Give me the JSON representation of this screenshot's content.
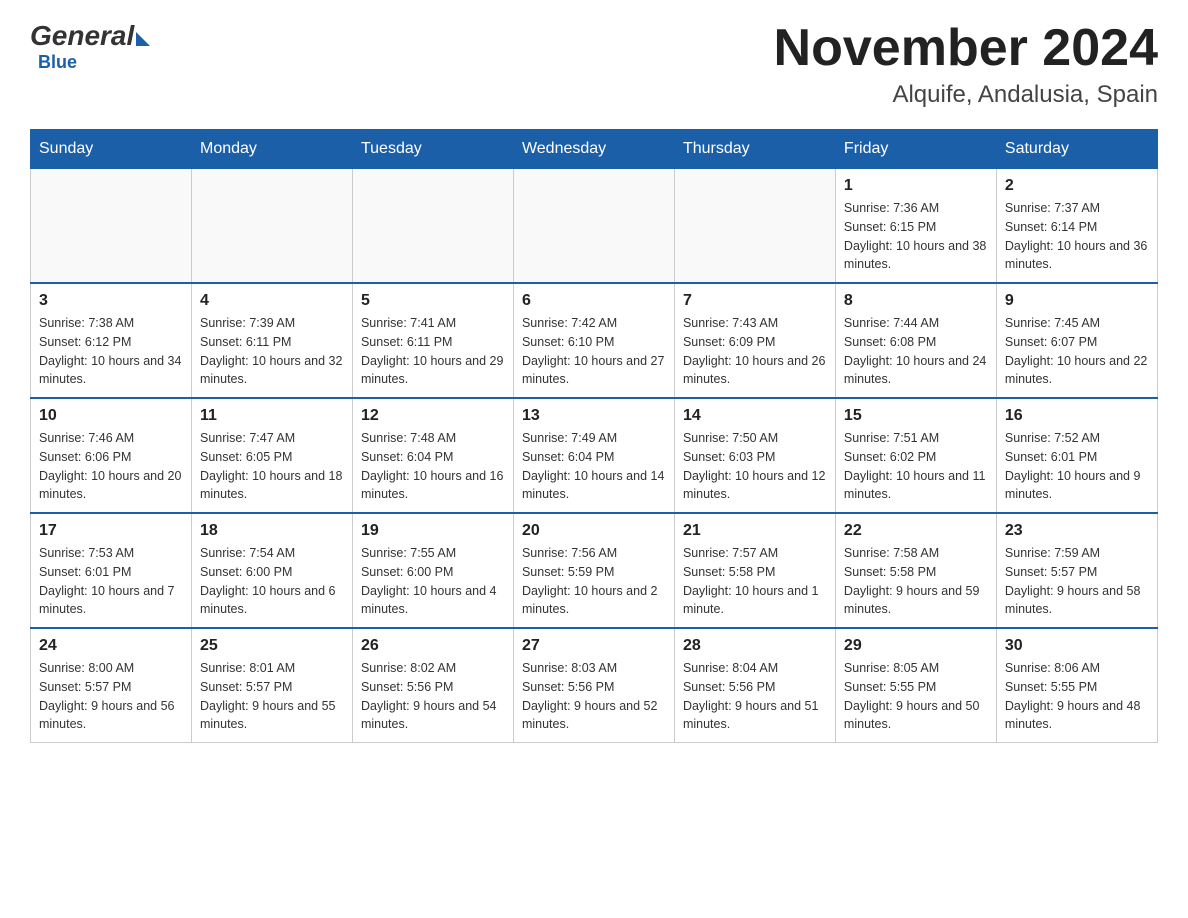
{
  "header": {
    "logo": {
      "general": "General",
      "blue": "Blue"
    },
    "title": "November 2024",
    "location": "Alquife, Andalusia, Spain"
  },
  "weekdays": [
    "Sunday",
    "Monday",
    "Tuesday",
    "Wednesday",
    "Thursday",
    "Friday",
    "Saturday"
  ],
  "weeks": [
    [
      {
        "day": "",
        "info": ""
      },
      {
        "day": "",
        "info": ""
      },
      {
        "day": "",
        "info": ""
      },
      {
        "day": "",
        "info": ""
      },
      {
        "day": "",
        "info": ""
      },
      {
        "day": "1",
        "info": "Sunrise: 7:36 AM\nSunset: 6:15 PM\nDaylight: 10 hours and 38 minutes."
      },
      {
        "day": "2",
        "info": "Sunrise: 7:37 AM\nSunset: 6:14 PM\nDaylight: 10 hours and 36 minutes."
      }
    ],
    [
      {
        "day": "3",
        "info": "Sunrise: 7:38 AM\nSunset: 6:12 PM\nDaylight: 10 hours and 34 minutes."
      },
      {
        "day": "4",
        "info": "Sunrise: 7:39 AM\nSunset: 6:11 PM\nDaylight: 10 hours and 32 minutes."
      },
      {
        "day": "5",
        "info": "Sunrise: 7:41 AM\nSunset: 6:11 PM\nDaylight: 10 hours and 29 minutes."
      },
      {
        "day": "6",
        "info": "Sunrise: 7:42 AM\nSunset: 6:10 PM\nDaylight: 10 hours and 27 minutes."
      },
      {
        "day": "7",
        "info": "Sunrise: 7:43 AM\nSunset: 6:09 PM\nDaylight: 10 hours and 26 minutes."
      },
      {
        "day": "8",
        "info": "Sunrise: 7:44 AM\nSunset: 6:08 PM\nDaylight: 10 hours and 24 minutes."
      },
      {
        "day": "9",
        "info": "Sunrise: 7:45 AM\nSunset: 6:07 PM\nDaylight: 10 hours and 22 minutes."
      }
    ],
    [
      {
        "day": "10",
        "info": "Sunrise: 7:46 AM\nSunset: 6:06 PM\nDaylight: 10 hours and 20 minutes."
      },
      {
        "day": "11",
        "info": "Sunrise: 7:47 AM\nSunset: 6:05 PM\nDaylight: 10 hours and 18 minutes."
      },
      {
        "day": "12",
        "info": "Sunrise: 7:48 AM\nSunset: 6:04 PM\nDaylight: 10 hours and 16 minutes."
      },
      {
        "day": "13",
        "info": "Sunrise: 7:49 AM\nSunset: 6:04 PM\nDaylight: 10 hours and 14 minutes."
      },
      {
        "day": "14",
        "info": "Sunrise: 7:50 AM\nSunset: 6:03 PM\nDaylight: 10 hours and 12 minutes."
      },
      {
        "day": "15",
        "info": "Sunrise: 7:51 AM\nSunset: 6:02 PM\nDaylight: 10 hours and 11 minutes."
      },
      {
        "day": "16",
        "info": "Sunrise: 7:52 AM\nSunset: 6:01 PM\nDaylight: 10 hours and 9 minutes."
      }
    ],
    [
      {
        "day": "17",
        "info": "Sunrise: 7:53 AM\nSunset: 6:01 PM\nDaylight: 10 hours and 7 minutes."
      },
      {
        "day": "18",
        "info": "Sunrise: 7:54 AM\nSunset: 6:00 PM\nDaylight: 10 hours and 6 minutes."
      },
      {
        "day": "19",
        "info": "Sunrise: 7:55 AM\nSunset: 6:00 PM\nDaylight: 10 hours and 4 minutes."
      },
      {
        "day": "20",
        "info": "Sunrise: 7:56 AM\nSunset: 5:59 PM\nDaylight: 10 hours and 2 minutes."
      },
      {
        "day": "21",
        "info": "Sunrise: 7:57 AM\nSunset: 5:58 PM\nDaylight: 10 hours and 1 minute."
      },
      {
        "day": "22",
        "info": "Sunrise: 7:58 AM\nSunset: 5:58 PM\nDaylight: 9 hours and 59 minutes."
      },
      {
        "day": "23",
        "info": "Sunrise: 7:59 AM\nSunset: 5:57 PM\nDaylight: 9 hours and 58 minutes."
      }
    ],
    [
      {
        "day": "24",
        "info": "Sunrise: 8:00 AM\nSunset: 5:57 PM\nDaylight: 9 hours and 56 minutes."
      },
      {
        "day": "25",
        "info": "Sunrise: 8:01 AM\nSunset: 5:57 PM\nDaylight: 9 hours and 55 minutes."
      },
      {
        "day": "26",
        "info": "Sunrise: 8:02 AM\nSunset: 5:56 PM\nDaylight: 9 hours and 54 minutes."
      },
      {
        "day": "27",
        "info": "Sunrise: 8:03 AM\nSunset: 5:56 PM\nDaylight: 9 hours and 52 minutes."
      },
      {
        "day": "28",
        "info": "Sunrise: 8:04 AM\nSunset: 5:56 PM\nDaylight: 9 hours and 51 minutes."
      },
      {
        "day": "29",
        "info": "Sunrise: 8:05 AM\nSunset: 5:55 PM\nDaylight: 9 hours and 50 minutes."
      },
      {
        "day": "30",
        "info": "Sunrise: 8:06 AM\nSunset: 5:55 PM\nDaylight: 9 hours and 48 minutes."
      }
    ]
  ]
}
